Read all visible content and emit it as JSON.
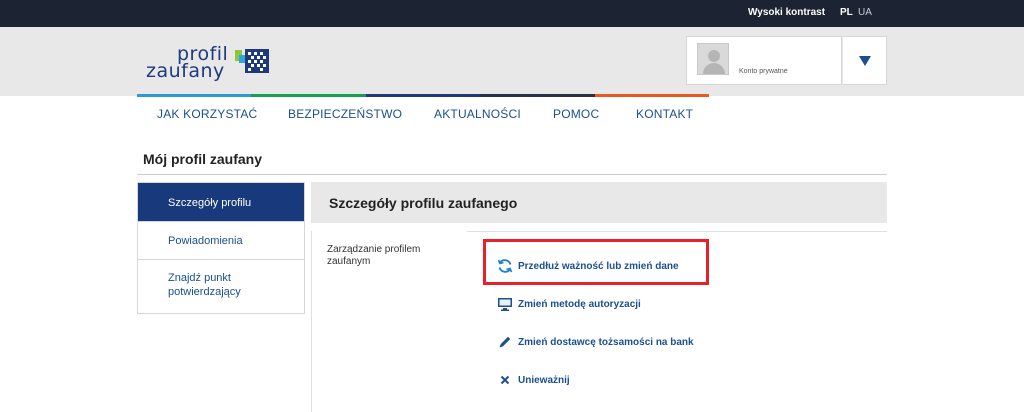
{
  "topbar": {
    "high_contrast": "Wysoki kontrast",
    "languages": [
      "PL",
      "UA"
    ]
  },
  "logo": {
    "line1": "profil",
    "line2": "zaufany"
  },
  "account": {
    "label": "Konto prywatne"
  },
  "colors": {
    "accent": "#1b4f8f",
    "active_nav": "#183a7c",
    "highlight": "#e8202a",
    "strip": [
      "#2a9bd6",
      "#14a050",
      "#1e3a7a",
      "#2a3344",
      "#e85a1e"
    ]
  },
  "nav": {
    "items": [
      "JAK KORZYSTAĆ",
      "BEZPIECZEŃSTWO",
      "AKTUALNOŚCI",
      "POMOC",
      "KONTAKT"
    ]
  },
  "page": {
    "title": "Mój profil zaufany"
  },
  "sidebar": {
    "items": [
      {
        "label": "Szczegóły profilu",
        "active": true
      },
      {
        "label": "Powiadomienia",
        "active": false
      },
      {
        "label": "Znajdź punkt potwierdzający",
        "active": false
      }
    ]
  },
  "content": {
    "heading": "Szczegóły profilu zaufanego",
    "section_label": "Zarządzanie profilem zaufanym",
    "actions": [
      {
        "label": "Przedłuż ważność lub zmień dane",
        "icon": "refresh-icon"
      },
      {
        "label": "Zmień metodę autoryzacji",
        "icon": "monitor-icon"
      },
      {
        "label": "Zmień dostawcę tożsamości na bank",
        "icon": "pencil-icon"
      },
      {
        "label": "Unieważnij",
        "icon": "close-icon"
      }
    ]
  }
}
